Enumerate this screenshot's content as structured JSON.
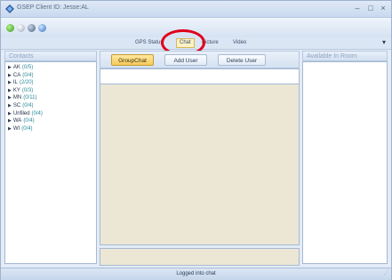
{
  "window": {
    "title": "GSEP Client ID: Jesse:AL",
    "minimize_glyph": "–",
    "maximize_glyph": "□",
    "close_glyph": "×"
  },
  "toolbar": {
    "icons": [
      "green-status-icon",
      "gray-status-icon",
      "connect-icon",
      "info-icon"
    ]
  },
  "tabs": [
    {
      "label": "GPS Status",
      "active": false
    },
    {
      "label": "Chat",
      "active": true
    },
    {
      "label": "Picture",
      "active": false
    },
    {
      "label": "Video",
      "active": false
    }
  ],
  "contacts": {
    "header": "Contacts",
    "items": [
      {
        "name": "AK",
        "count": "(0/5)"
      },
      {
        "name": "CA",
        "count": "(0/4)"
      },
      {
        "name": "IL",
        "count": "(2/20)"
      },
      {
        "name": "KY",
        "count": "(0/3)"
      },
      {
        "name": "MN",
        "count": "(0/11)"
      },
      {
        "name": "SC",
        "count": "(0/4)"
      },
      {
        "name": "Unfiled",
        "count": "(0/4)"
      },
      {
        "name": "WA",
        "count": "(0/4)"
      },
      {
        "name": "WI",
        "count": "(0/4)"
      }
    ]
  },
  "chat": {
    "buttons": {
      "group_chat": "GroupChat",
      "add_user": "Add User",
      "delete_user": "Delete User"
    }
  },
  "room": {
    "header": "Available In Room"
  },
  "status": {
    "text": "Logged into chat"
  },
  "colors": {
    "highlight_circle": "#e0001a",
    "active_button": "#f7ca5a",
    "chat_background": "#ece7d4",
    "count_text": "#2a8a9a"
  }
}
